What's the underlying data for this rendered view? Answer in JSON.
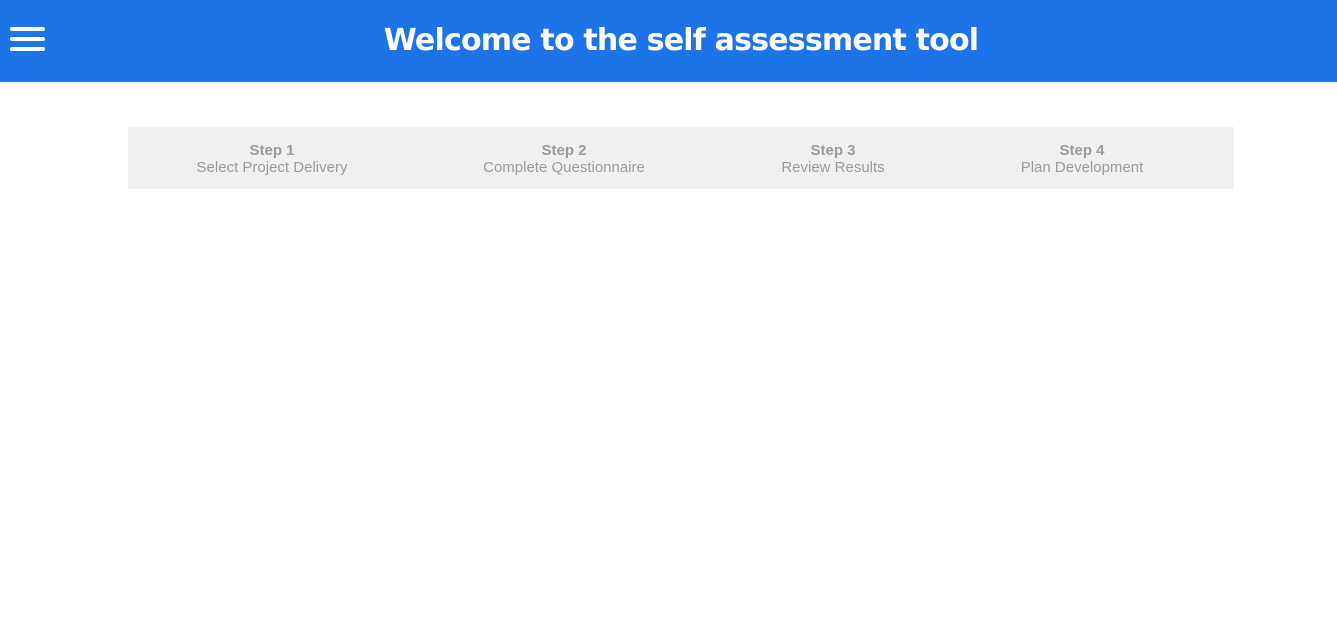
{
  "header": {
    "title": "Welcome to the self assessment tool",
    "menu_icon": "hamburger-menu-icon",
    "background_color": "#1d74e8"
  },
  "stepper": {
    "background_color": "#f0f0f0",
    "text_color": "#9a9a9a",
    "steps": [
      {
        "number": "Step 1",
        "label": "Select Project Delivery"
      },
      {
        "number": "Step 2",
        "label": "Complete Questionnaire"
      },
      {
        "number": "Step 3",
        "label": "Review Results"
      },
      {
        "number": "Step 4",
        "label": "Plan Development"
      }
    ]
  }
}
